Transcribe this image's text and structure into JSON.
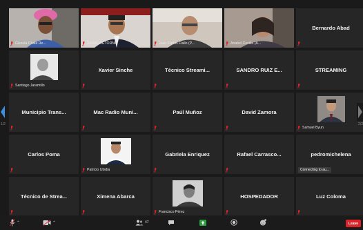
{
  "colors": {
    "tile_bg": "#262626",
    "mic_muted": "#d8252b",
    "leave_red": "#d8252b",
    "share_green": "#2ea043"
  },
  "tiles": [
    {
      "id": "t01",
      "kind": "video",
      "name": "Gissela Chalá Re...",
      "icon": "woman-headwrap-video"
    },
    {
      "id": "t02",
      "kind": "video",
      "name": "SEÑAL RETORNO",
      "icon": "man-suit-video"
    },
    {
      "id": "t03",
      "kind": "video",
      "name": "Juan Carlos Fiallo (P...",
      "icon": "man-glasses-video"
    },
    {
      "id": "t04",
      "kind": "video",
      "name": "Anabel Cecilia (A...",
      "icon": "woman-video"
    },
    {
      "id": "t05",
      "kind": "name",
      "name": "Bernardo Abad"
    },
    {
      "id": "t06",
      "kind": "photo",
      "name": "Santiago Jaramillo",
      "icon": "man-photo"
    },
    {
      "id": "t07",
      "kind": "name",
      "name": "Xavier Sinche"
    },
    {
      "id": "t08",
      "kind": "name",
      "name": "Técnico Streami..."
    },
    {
      "id": "t09",
      "kind": "name",
      "name": "SANDRO RUIZ E..."
    },
    {
      "id": "t10",
      "kind": "name",
      "name": "STREAMING"
    },
    {
      "id": "t11",
      "kind": "name",
      "name": "Municipio Trans..."
    },
    {
      "id": "t12",
      "kind": "name",
      "name": "Mac Radio Muni..."
    },
    {
      "id": "t13",
      "kind": "name",
      "name": "Paúl Muñoz"
    },
    {
      "id": "t14",
      "kind": "name",
      "name": "David Zamora"
    },
    {
      "id": "t15",
      "kind": "photo",
      "name": "Samuel Byun",
      "icon": "man-suit-photo"
    },
    {
      "id": "t16",
      "kind": "name",
      "name": "Carlos Poma"
    },
    {
      "id": "t17",
      "kind": "photo",
      "name": "Patricio Ubidia",
      "icon": "man-shirt-photo"
    },
    {
      "id": "t18",
      "kind": "name",
      "name": "Gabriela Enriquez"
    },
    {
      "id": "t19",
      "kind": "name",
      "name": "Rafael Carrasco..."
    },
    {
      "id": "t20",
      "kind": "name",
      "name": "pedromichelena",
      "status": "Connecting to au..."
    },
    {
      "id": "t21",
      "kind": "name",
      "name": "Técnico de Strea..."
    },
    {
      "id": "t22",
      "kind": "name",
      "name": "Ximena Abarca"
    },
    {
      "id": "t23",
      "kind": "photo",
      "name": "Francisco Pérez",
      "icon": "man-bw-photo"
    },
    {
      "id": "t24",
      "kind": "name",
      "name": "HOSPEDADOR"
    },
    {
      "id": "t25",
      "kind": "name",
      "name": "Luz Coloma"
    }
  ],
  "paging": {
    "left_page": "1/2",
    "right_page": "2/2"
  },
  "toolbar": {
    "participants_count": "47",
    "leave_label": "Leave",
    "items": [
      "mic-icon",
      "camera-icon",
      "participants-icon",
      "chat-icon",
      "share-screen-icon",
      "record-icon",
      "reactions-icon"
    ]
  }
}
